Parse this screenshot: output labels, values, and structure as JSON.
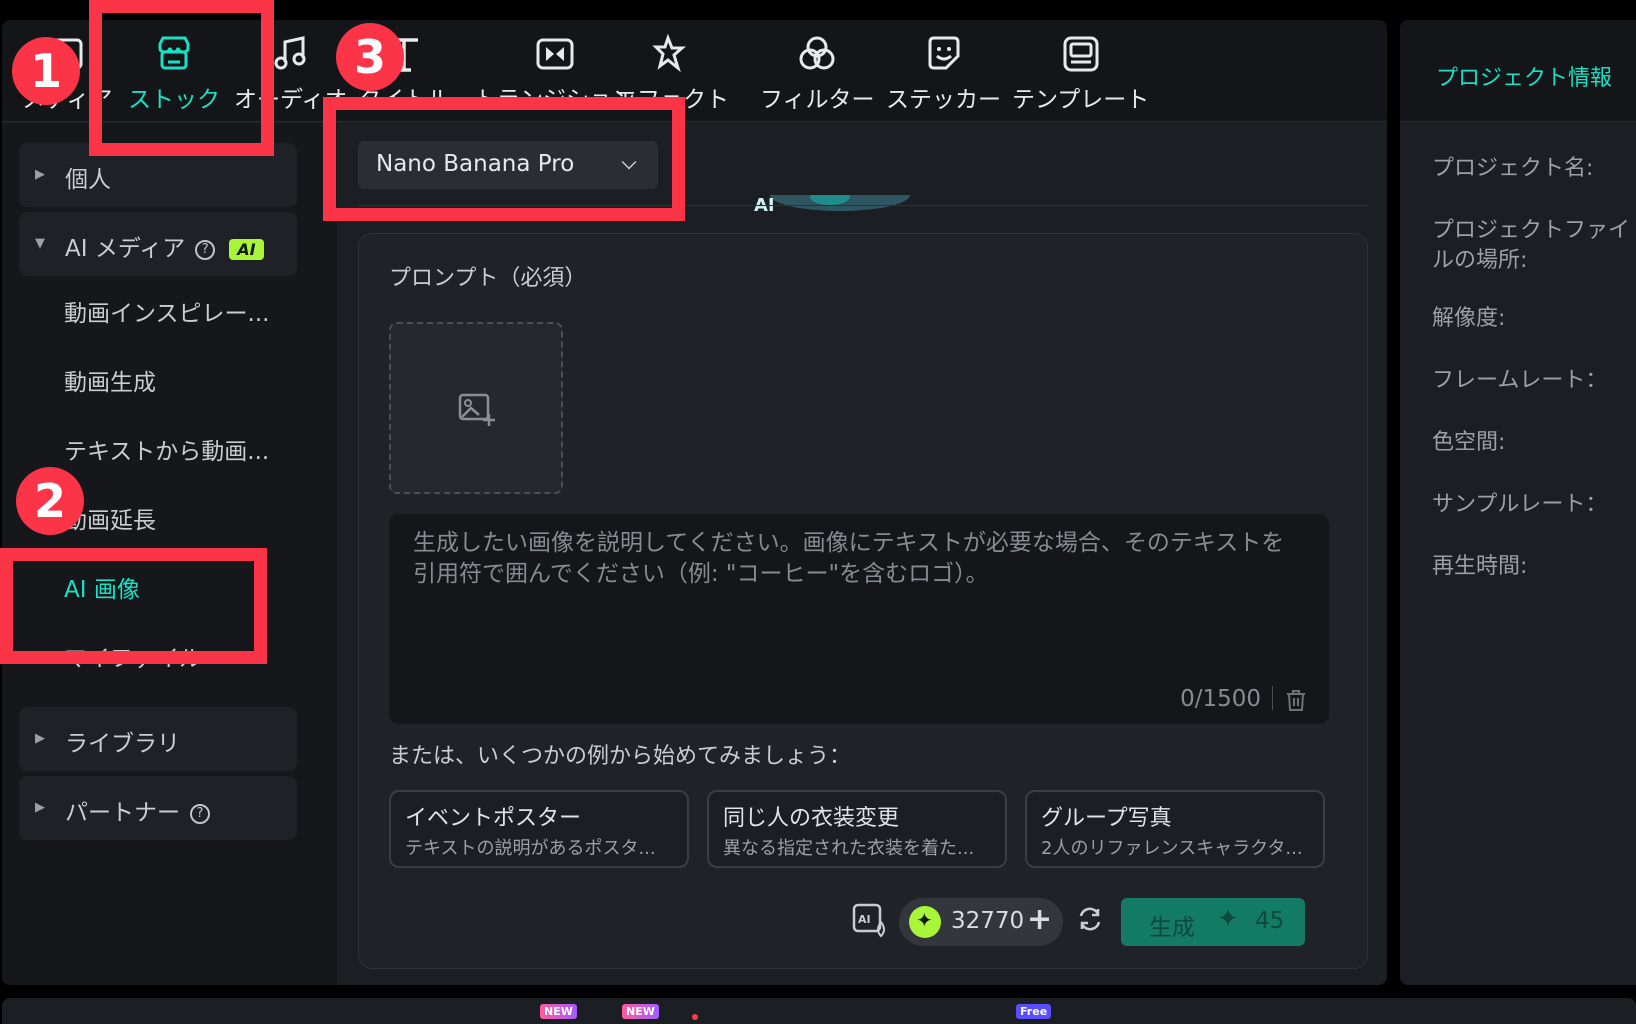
{
  "toolbar": {
    "tabs": [
      {
        "label": "メディア",
        "icon": "media-icon"
      },
      {
        "label": "ストック",
        "icon": "stock-store-icon",
        "active": true
      },
      {
        "label": "オーディオ",
        "icon": "music-note-icon"
      },
      {
        "label": "タイトル",
        "icon": "title-text-icon"
      },
      {
        "label": "トランジション",
        "icon": "transition-icon"
      },
      {
        "label": "エフェクト",
        "icon": "effect-sparkle-icon"
      },
      {
        "label": "フィルター",
        "icon": "filter-icon"
      },
      {
        "label": "ステッカー",
        "icon": "sticker-icon"
      },
      {
        "label": "テンプレート",
        "icon": "template-icon"
      }
    ]
  },
  "sidebar": {
    "personal": "個人",
    "ai_media": "AI メディア",
    "ai_badge": "AI",
    "items": [
      "動画インスピレー...",
      "動画生成",
      "テキストから動画...",
      "動画延長",
      "AI 画像",
      "マイファイル"
    ],
    "active_item": "AI 画像",
    "library": "ライブラリ",
    "partner": "パートナー"
  },
  "content": {
    "model_select": "Nano Banana Pro",
    "prompt_title": "プロンプト（必須）",
    "prompt_placeholder": "生成したい画像を説明してください。画像にテキストが必要な場合、そのテキストを引用符で囲んでください（例: \"コーヒー\"を含むロゴ）。",
    "counter": "0/1500",
    "examples_hint": "または、いくつかの例から始めてみましょう：",
    "examples": [
      {
        "title": "イベントポスター",
        "desc": "テキストの説明があるポスタ..."
      },
      {
        "title": "同じ人の衣装変更",
        "desc": "異なる指定された衣装を着た..."
      },
      {
        "title": "グループ写真",
        "desc": "2人のリファレンスキャラクタ..."
      }
    ],
    "credits": "32770",
    "generate_label": "生成",
    "generate_cost": "45"
  },
  "right_panel": {
    "title": "プロジェクト情報",
    "labels": [
      "プロジェクト名:",
      "プロジェクトファイルの場所:",
      "解像度:",
      "フレームレート：",
      "色空間:",
      "サンプルレート：",
      "再生時間:"
    ]
  },
  "bottom_bar": {
    "badges": [
      "NEW",
      "NEW",
      "Free"
    ]
  },
  "annotations": {
    "steps": [
      "1",
      "2",
      "3"
    ],
    "color": "#fb3447"
  },
  "colors": {
    "accent": "#19e0c4",
    "ai_badge": "#a9f53a",
    "generate_button": "#137a66"
  }
}
